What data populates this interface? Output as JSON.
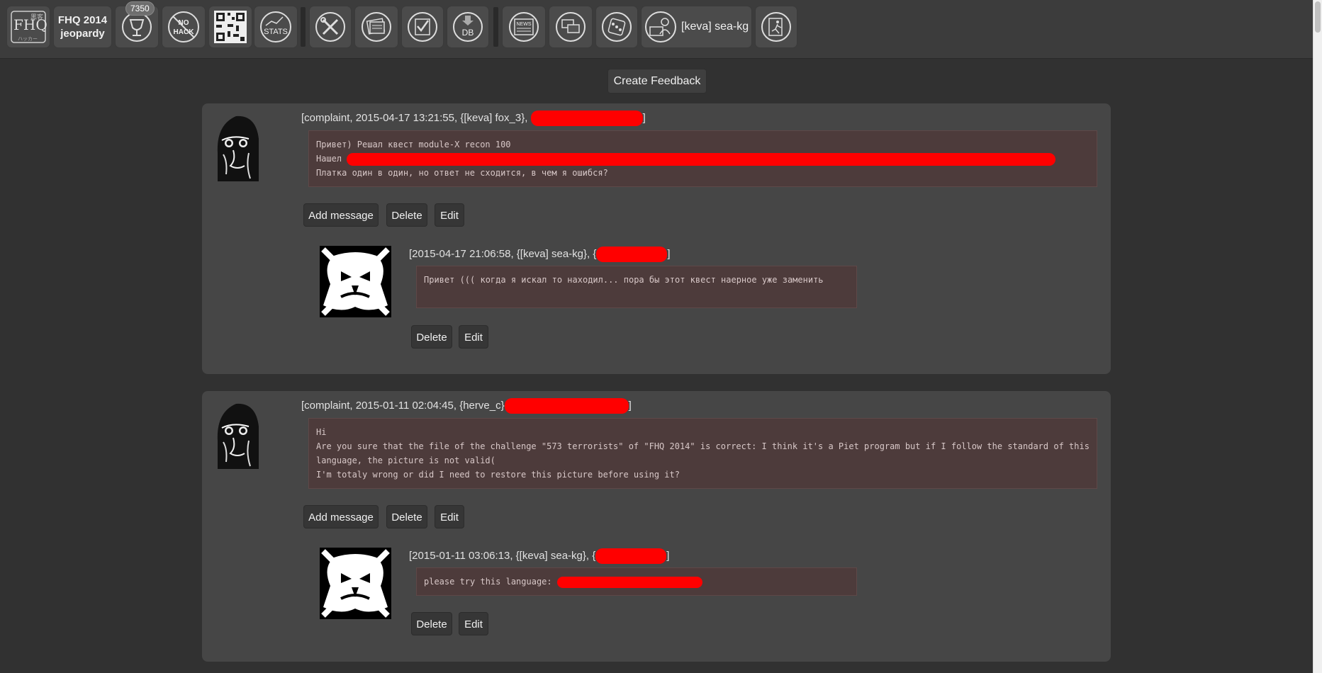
{
  "toolbar": {
    "brand_line1": "FHQ 2014",
    "brand_line2": "jeopardy",
    "score_badge": "7350",
    "user_label": "[keva] sea-kg",
    "icons": [
      "fhq-logo-icon",
      "brand",
      "trophy-icon",
      "no-hack-icon",
      "qr-code-icon",
      "stats-icon",
      "tools-icon",
      "newspaper-stack-icon",
      "checklist-icon",
      "database-icon",
      "news-icon",
      "feedback-icon",
      "dice-icon",
      "user-icon",
      "exit-icon"
    ],
    "logo_text": "FHQ",
    "no_hack_text": "NO HACK",
    "stats_text": "STATS",
    "db_text": "DB",
    "news_text": "NEWS"
  },
  "create_feedback_label": "Create Feedback",
  "feedback": [
    {
      "meta_prefix": "[complaint, 2015-04-17 13:21:55, {[keva] fox_3}, ",
      "meta_suffix": "]",
      "lines": [
        "Привет) Решал квест module-X recon 100",
        "Нашел ",
        "Платка один в один, но ответ не сходится, в чем я ошибся?"
      ],
      "actions": {
        "add": "Add message",
        "delete": "Delete",
        "edit": "Edit"
      },
      "reply": {
        "meta_prefix": "[2015-04-17 21:06:58, {[keva] sea-kg}, {",
        "meta_suffix": "]",
        "text": "Привет ((( когда я искал то находил... пора бы этот квест наерное уже заменить",
        "actions": {
          "delete": "Delete",
          "edit": "Edit"
        }
      }
    },
    {
      "meta_prefix": "[complaint, 2015-01-11 02:04:45, {herve_c}",
      "meta_suffix": "]",
      "lines": [
        "Hi",
        "Are you sure that the file of the challenge \"573 terrorists\" of \"FHQ 2014\" is correct: I think it's a Piet program but if I follow the standard of this language, the picture is not valid(",
        "I'm totaly wrong or did I need to restore this picture before using it?"
      ],
      "actions": {
        "add": "Add message",
        "delete": "Delete",
        "edit": "Edit"
      },
      "reply": {
        "meta_prefix": "[2015-01-11 03:06:13, {[keva] sea-kg}, {",
        "meta_suffix": "]",
        "text": "please try this language: ",
        "actions": {
          "delete": "Delete",
          "edit": "Edit"
        }
      }
    }
  ]
}
